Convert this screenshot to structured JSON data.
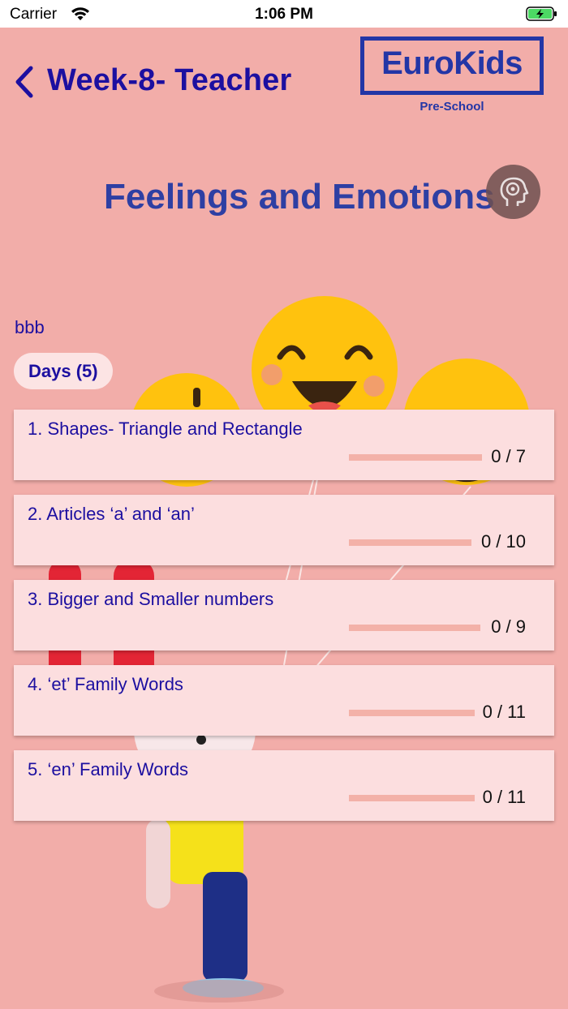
{
  "status_bar": {
    "carrier": "Carrier",
    "time": "1:06 PM"
  },
  "header": {
    "title": "Week-8- Teacher",
    "logo_text": "EuroKids",
    "logo_sub": "Pre-School"
  },
  "banner": {
    "title": "Feelings and Emotions"
  },
  "subtitle": "bbb",
  "days_label": "Days (5)",
  "days": [
    {
      "title": "1. Shapes- Triangle and Rectangle",
      "progress": "0 / 7",
      "completed": 0,
      "total": 7
    },
    {
      "title": "2. Articles ‘a’ and ‘an’",
      "progress": "0 / 10",
      "completed": 0,
      "total": 10
    },
    {
      "title": "3. Bigger and Smaller numbers",
      "progress": "0 / 9",
      "completed": 0,
      "total": 9
    },
    {
      "title": "4. ‘et’ Family Words",
      "progress": "0 / 11",
      "completed": 0,
      "total": 11
    },
    {
      "title": "5. ‘en’ Family Words",
      "progress": "0 / 11",
      "completed": 0,
      "total": 11
    }
  ],
  "colors": {
    "background": "#F2ADA9",
    "accent_text": "#1C0FA0",
    "card": "#FCDEDF",
    "progress_track": "#F3B1A8"
  },
  "icons": {
    "back": "chevron-left-icon",
    "mind": "head-mind-icon",
    "wifi": "wifi-icon",
    "battery": "battery-charging-icon"
  }
}
